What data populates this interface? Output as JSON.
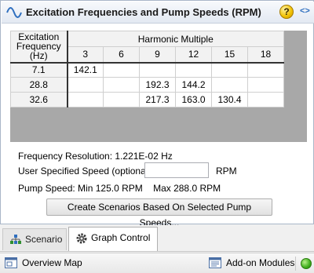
{
  "panel": {
    "title": "Excitation Frequencies and Pump Speeds (RPM)",
    "help_glyph": "?",
    "nav_glyph": "<>"
  },
  "table": {
    "corner_header": [
      "Excitation",
      "Frequency",
      "(Hz)"
    ],
    "group_header": "Harmonic Multiple",
    "harmonics": [
      "3",
      "6",
      "9",
      "12",
      "15",
      "18"
    ],
    "rows": [
      {
        "freq": "7.1",
        "cells": [
          "142.1",
          "",
          "",
          "",
          "",
          ""
        ]
      },
      {
        "freq": "28.8",
        "cells": [
          "",
          "",
          "192.3",
          "144.2",
          "",
          ""
        ]
      },
      {
        "freq": "32.6",
        "cells": [
          "",
          "",
          "217.3",
          "163.0",
          "130.4",
          ""
        ]
      }
    ]
  },
  "info": {
    "resolution_text": "Frequency Resolution: 1.221E-02 Hz",
    "user_speed_label": "User Specified Speed (optional):",
    "user_speed_value": "",
    "rpm_label": "RPM",
    "pump_speed_text": "Pump Speed: Min 125.0 RPM    Max 288.0 RPM"
  },
  "create_button": "Create Scenarios Based On Selected Pump Speeds...",
  "tabs": [
    {
      "label": "Scenario",
      "active": false
    },
    {
      "label": "Graph Control",
      "active": true
    }
  ],
  "statusbar": {
    "overview_map": "Overview Map",
    "addon_modules": "Add-on Modules"
  },
  "colors": {
    "grid_background": "#a8a8a8",
    "status_indicator": "#3fae1c",
    "help_icon": "#f0c000"
  }
}
